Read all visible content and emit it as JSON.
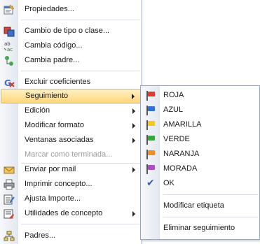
{
  "main_menu": {
    "items": [
      {
        "label": "Propiedades...",
        "mnemonic": "P",
        "icon": "properties-icon"
      },
      {
        "label": "Cambio de tipo o clase...",
        "icon": "change-type-icon"
      },
      {
        "label": "Cambia código...",
        "mnemonic": "c",
        "icon": "change-code-icon"
      },
      {
        "label": "Cambia padre...",
        "mnemonic": "p",
        "icon": "change-parent-icon"
      },
      {
        "label": "Excluir coeficientes",
        "icon": "exclude-coefficients-icon"
      },
      {
        "label": "Seguimiento",
        "highlighted": true
      },
      {
        "label": "Edición"
      },
      {
        "label": "Modificar formato"
      },
      {
        "label": "Ventanas asociadas"
      },
      {
        "label": "Marcar como terminada...",
        "disabled": true
      },
      {
        "label": "Enviar por mail",
        "icon": "mail-icon"
      },
      {
        "label": "Imprimir concepto...",
        "icon": "printer-icon"
      },
      {
        "label": "Ajusta Importe...",
        "icon": "adjust-amount-icon"
      },
      {
        "label": "Utilidades de concepto",
        "icon": "utilities-icon"
      },
      {
        "label": "Padres...",
        "icon": "parents-icon"
      }
    ]
  },
  "tracking_submenu": {
    "items": [
      {
        "label": "ROJA",
        "color": "#e23b2e"
      },
      {
        "label": "AZUL",
        "color": "#2f6fd6"
      },
      {
        "label": "AMARILLA",
        "color": "#f2c81a"
      },
      {
        "label": "VERDE",
        "color": "#3aa53a"
      },
      {
        "label": "NARANJA",
        "color": "#f28c1c"
      },
      {
        "label": "MORADA",
        "color": "#a84fc2"
      },
      {
        "label": "OK",
        "checked": true
      },
      {
        "label": "Modificar etiqueta"
      },
      {
        "label": "Eliminar seguimiento"
      }
    ]
  },
  "colors": {
    "highlight_top": "#fff1c4",
    "highlight_bottom": "#ffd67a",
    "highlight_border": "#e3b74a",
    "menu_border": "#9aa6b8"
  }
}
